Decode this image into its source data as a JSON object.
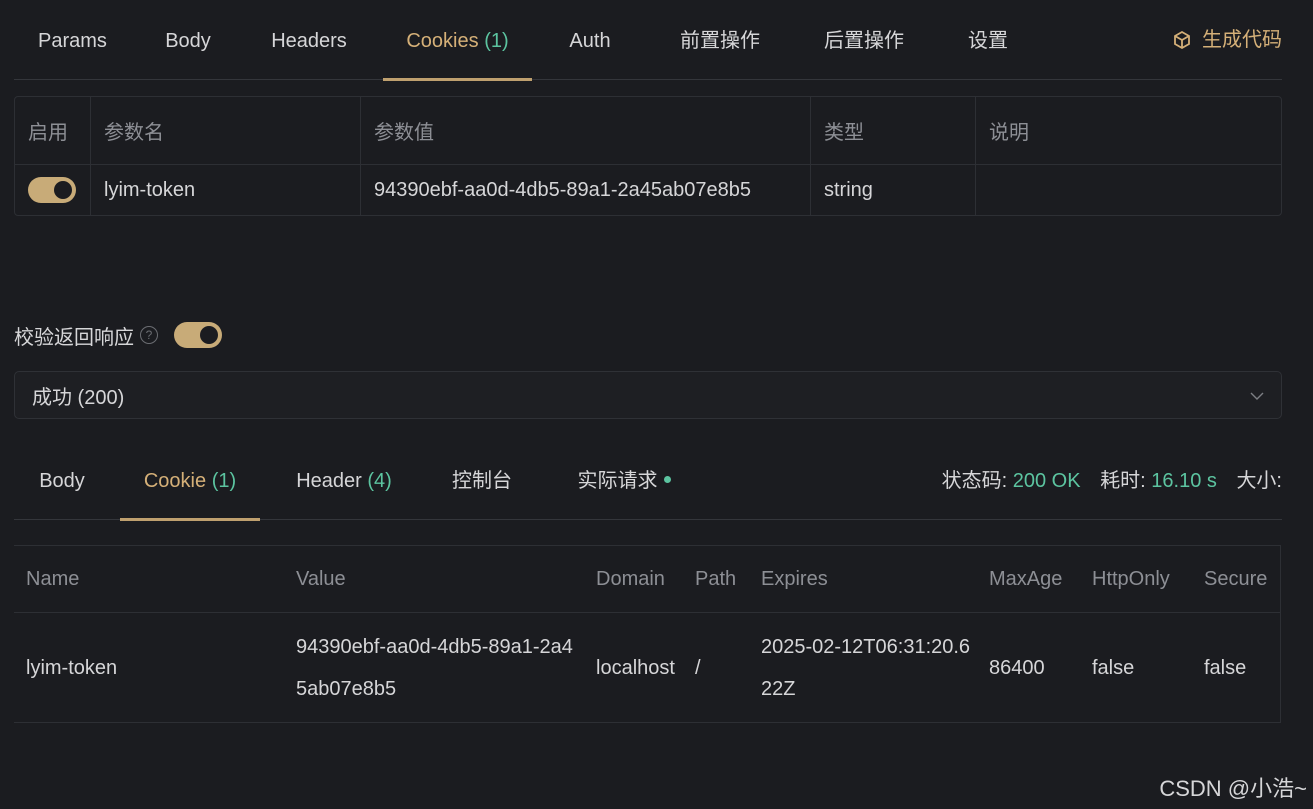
{
  "request_tabs": [
    {
      "label": "Params",
      "count": ""
    },
    {
      "label": "Body",
      "count": ""
    },
    {
      "label": "Headers",
      "count": ""
    },
    {
      "label": "Cookies",
      "count": "(1)"
    },
    {
      "label": "Auth",
      "count": ""
    },
    {
      "label": "前置操作",
      "count": ""
    },
    {
      "label": "后置操作",
      "count": ""
    },
    {
      "label": "设置",
      "count": ""
    }
  ],
  "generate_code_label": "生成代码",
  "cookie_params": {
    "headers": [
      "启用",
      "参数名",
      "参数值",
      "类型",
      "说明"
    ],
    "rows": [
      {
        "enabled": true,
        "name": "lyim-token",
        "value": "94390ebf-aa0d-4db5-89a1-2a45ab07e8b5",
        "type": "string",
        "desc": ""
      }
    ]
  },
  "validate": {
    "label": "校验返回响应",
    "help": "?",
    "enabled": true
  },
  "response_select": {
    "value": "成功 (200)"
  },
  "response_tabs": [
    {
      "label": "Body",
      "count": ""
    },
    {
      "label": "Cookie",
      "count": "(1)"
    },
    {
      "label": "Header",
      "count": "(4)"
    },
    {
      "label": "控制台",
      "count": ""
    },
    {
      "label": "实际请求",
      "count": ""
    }
  ],
  "stats": {
    "status_label": "状态码:",
    "status_value": "200 OK",
    "time_label": "耗时:",
    "time_value": "16.10 s",
    "size_label": "大小:"
  },
  "response_cookies": {
    "headers": [
      "Name",
      "Value",
      "Domain",
      "Path",
      "Expires",
      "MaxAge",
      "HttpOnly",
      "Secure"
    ],
    "rows": [
      [
        "lyim-token",
        "94390ebf-aa0d-4db5-89a1-2a45ab07e8b5",
        "localhost",
        "/",
        "2025-02-12T06:31:20.622Z",
        "86400",
        "false",
        "false"
      ]
    ]
  },
  "watermark": "CSDN @小浩~",
  "colors": {
    "accent": "#d5b078",
    "count": "#5cc4a0",
    "background": "#1b1c20"
  }
}
